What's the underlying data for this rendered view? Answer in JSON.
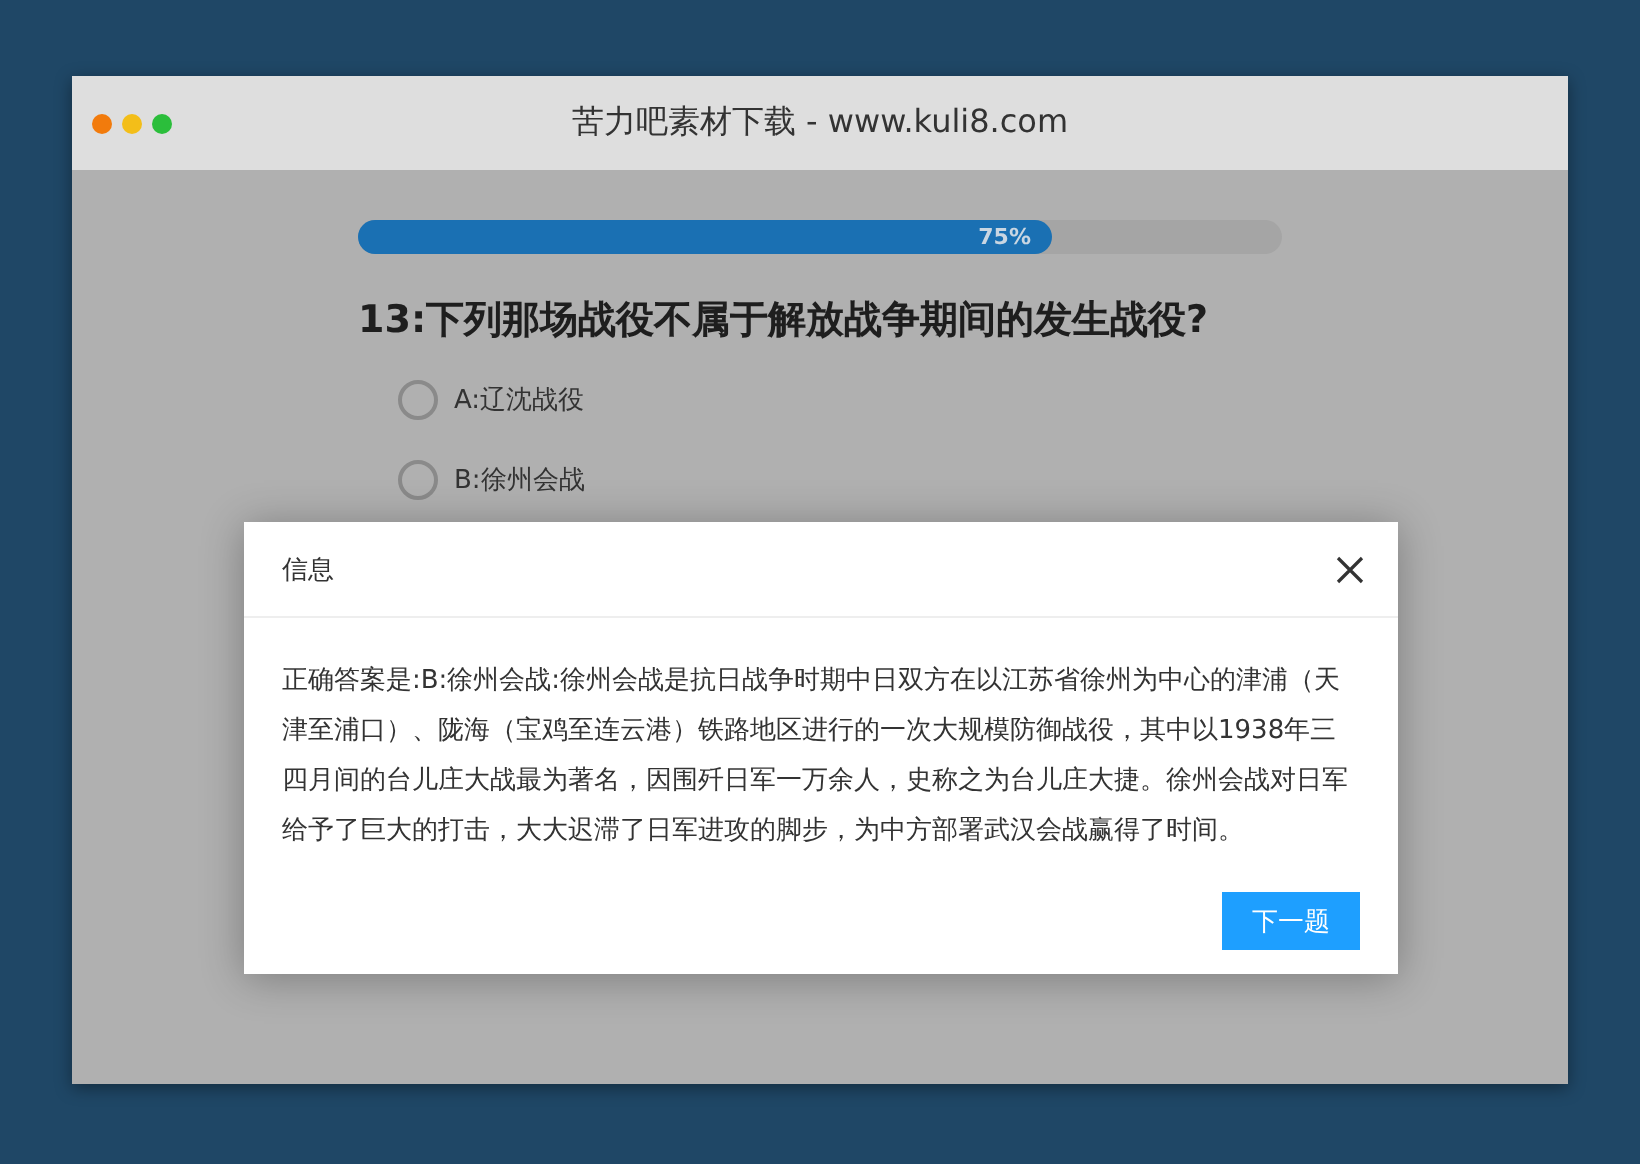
{
  "window": {
    "title": "苦力吧素材下载 - www.kuli8.com"
  },
  "progress": {
    "level": 0.75,
    "label": "75%"
  },
  "question": "13:下列那场战役不属于解放战争期间的发生战役?",
  "options": [
    {
      "label": "A:辽沈战役",
      "selected": false
    },
    {
      "label": "B:徐州会战",
      "selected": false
    }
  ],
  "dialog": {
    "title": "信息",
    "message": "正确答案是:B:徐州会战:徐州会战是抗日战争时期中日双方在以江苏省徐州为中心的津浦（天津至浦口）、陇海（宝鸡至连云港）铁路地区进行的一次大规模防御战役，其中以1938年三四月间的台儿庄大战最为著名，因围歼日军一万余人，史称之为台儿庄大捷。徐州会战对日军给予了巨大的打击，大大迟滞了日军进攻的脚步，为中方部署武汉会战赢得了时间。",
    "button": "下一题"
  }
}
